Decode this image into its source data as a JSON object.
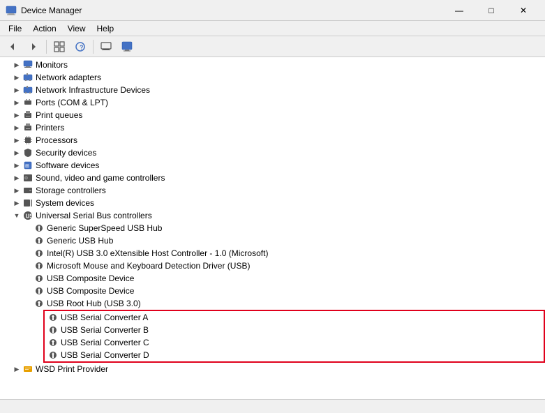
{
  "window": {
    "title": "Device Manager",
    "controls": {
      "minimize": "—",
      "maximize": "□",
      "close": "✕"
    }
  },
  "menu": {
    "items": [
      "File",
      "Action",
      "View",
      "Help"
    ]
  },
  "toolbar": {
    "buttons": [
      "◀",
      "▶",
      "⊞",
      "?",
      "⊡",
      "🖥"
    ]
  },
  "tree": {
    "items": [
      {
        "id": "monitors",
        "label": "Monitors",
        "indent": 1,
        "arrow": "▶",
        "icon": "monitor",
        "expanded": false
      },
      {
        "id": "network-adapters",
        "label": "Network adapters",
        "indent": 1,
        "arrow": "▶",
        "icon": "network",
        "expanded": false
      },
      {
        "id": "network-infra",
        "label": "Network Infrastructure Devices",
        "indent": 1,
        "arrow": "▶",
        "icon": "network",
        "expanded": false
      },
      {
        "id": "ports",
        "label": "Ports (COM & LPT)",
        "indent": 1,
        "arrow": "▶",
        "icon": "port",
        "expanded": false
      },
      {
        "id": "print-queues",
        "label": "Print queues",
        "indent": 1,
        "arrow": "▶",
        "icon": "printer",
        "expanded": false
      },
      {
        "id": "printers",
        "label": "Printers",
        "indent": 1,
        "arrow": "▶",
        "icon": "printer",
        "expanded": false
      },
      {
        "id": "processors",
        "label": "Processors",
        "indent": 1,
        "arrow": "▶",
        "icon": "processor",
        "expanded": false
      },
      {
        "id": "security",
        "label": "Security devices",
        "indent": 1,
        "arrow": "▶",
        "icon": "security",
        "expanded": false
      },
      {
        "id": "software",
        "label": "Software devices",
        "indent": 1,
        "arrow": "▶",
        "icon": "software",
        "expanded": false
      },
      {
        "id": "sound",
        "label": "Sound, video and game controllers",
        "indent": 1,
        "arrow": "▶",
        "icon": "sound",
        "expanded": false
      },
      {
        "id": "storage",
        "label": "Storage controllers",
        "indent": 1,
        "arrow": "▶",
        "icon": "storage",
        "expanded": false
      },
      {
        "id": "system",
        "label": "System devices",
        "indent": 1,
        "arrow": "▶",
        "icon": "system",
        "expanded": false
      },
      {
        "id": "usb",
        "label": "Universal Serial Bus controllers",
        "indent": 1,
        "arrow": "▼",
        "icon": "usb",
        "expanded": true
      },
      {
        "id": "usb-superspeed",
        "label": "Generic SuperSpeed USB Hub",
        "indent": 2,
        "arrow": "",
        "icon": "usb-device",
        "expanded": false,
        "child": true
      },
      {
        "id": "usb-generic",
        "label": "Generic USB Hub",
        "indent": 2,
        "arrow": "",
        "icon": "usb-device",
        "expanded": false,
        "child": true
      },
      {
        "id": "usb-intel",
        "label": "Intel(R) USB 3.0 eXtensible Host Controller - 1.0 (Microsoft)",
        "indent": 2,
        "arrow": "",
        "icon": "usb-device",
        "expanded": false,
        "child": true
      },
      {
        "id": "usb-mouse",
        "label": "Microsoft Mouse and Keyboard Detection Driver (USB)",
        "indent": 2,
        "arrow": "",
        "icon": "usb-device",
        "expanded": false,
        "child": true
      },
      {
        "id": "usb-composite1",
        "label": "USB Composite Device",
        "indent": 2,
        "arrow": "",
        "icon": "usb-device",
        "expanded": false,
        "child": true
      },
      {
        "id": "usb-composite2",
        "label": "USB Composite Device",
        "indent": 2,
        "arrow": "",
        "icon": "usb-device",
        "expanded": false,
        "child": true
      },
      {
        "id": "usb-root",
        "label": "USB Root Hub (USB 3.0)",
        "indent": 2,
        "arrow": "",
        "icon": "usb-device",
        "expanded": false,
        "child": true
      }
    ],
    "highlighted": [
      {
        "id": "usb-serial-a",
        "label": "USB Serial Converter A",
        "icon": "usb-device"
      },
      {
        "id": "usb-serial-b",
        "label": "USB Serial Converter B",
        "icon": "usb-device"
      },
      {
        "id": "usb-serial-c",
        "label": "USB Serial Converter C",
        "icon": "usb-device"
      },
      {
        "id": "usb-serial-d",
        "label": "USB Serial Converter D",
        "icon": "usb-device"
      }
    ],
    "after_highlighted": [
      {
        "id": "wsd",
        "label": "WSD Print Provider",
        "indent": 1,
        "arrow": "▶",
        "icon": "folder",
        "expanded": false
      }
    ]
  }
}
